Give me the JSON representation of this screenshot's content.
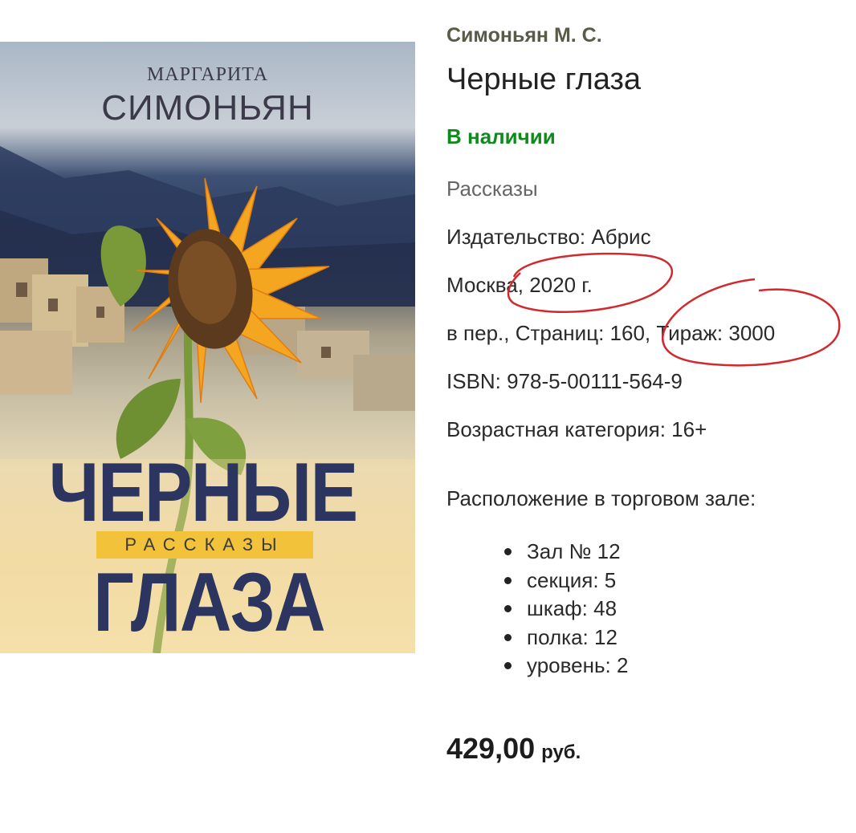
{
  "cover": {
    "author_first": "МАРГАРИТА",
    "author_last": "СИМОНЬЯН",
    "title_line1": "ЧЕРНЫЕ",
    "subtitle": "РАССКАЗЫ",
    "title_line2": "ГЛАЗА"
  },
  "product": {
    "author": "Симоньян М. С.",
    "title": "Черные глаза",
    "availability": "В наличии",
    "genre": "Рассказы",
    "publisher": "Издательство: Абрис",
    "city_year": "Москва, 2020 г.",
    "pages_print_run": "в пер., Страниц: 160, Тираж: 3000",
    "isbn": "ISBN: 978-5-00111-564-9",
    "age_category": "Возрастная категория: 16+"
  },
  "location": {
    "heading": "Расположение в торговом зале:",
    "items": [
      "Зал № 12",
      "секция: 5",
      "шкаф: 48",
      "полка: 12",
      "уровень: 2"
    ]
  },
  "price": {
    "amount": "429,00",
    "currency": "руб."
  },
  "colors": {
    "availability": "#0f8a1c",
    "annotation": "#d0292e",
    "cover_title": "#2b3560"
  }
}
